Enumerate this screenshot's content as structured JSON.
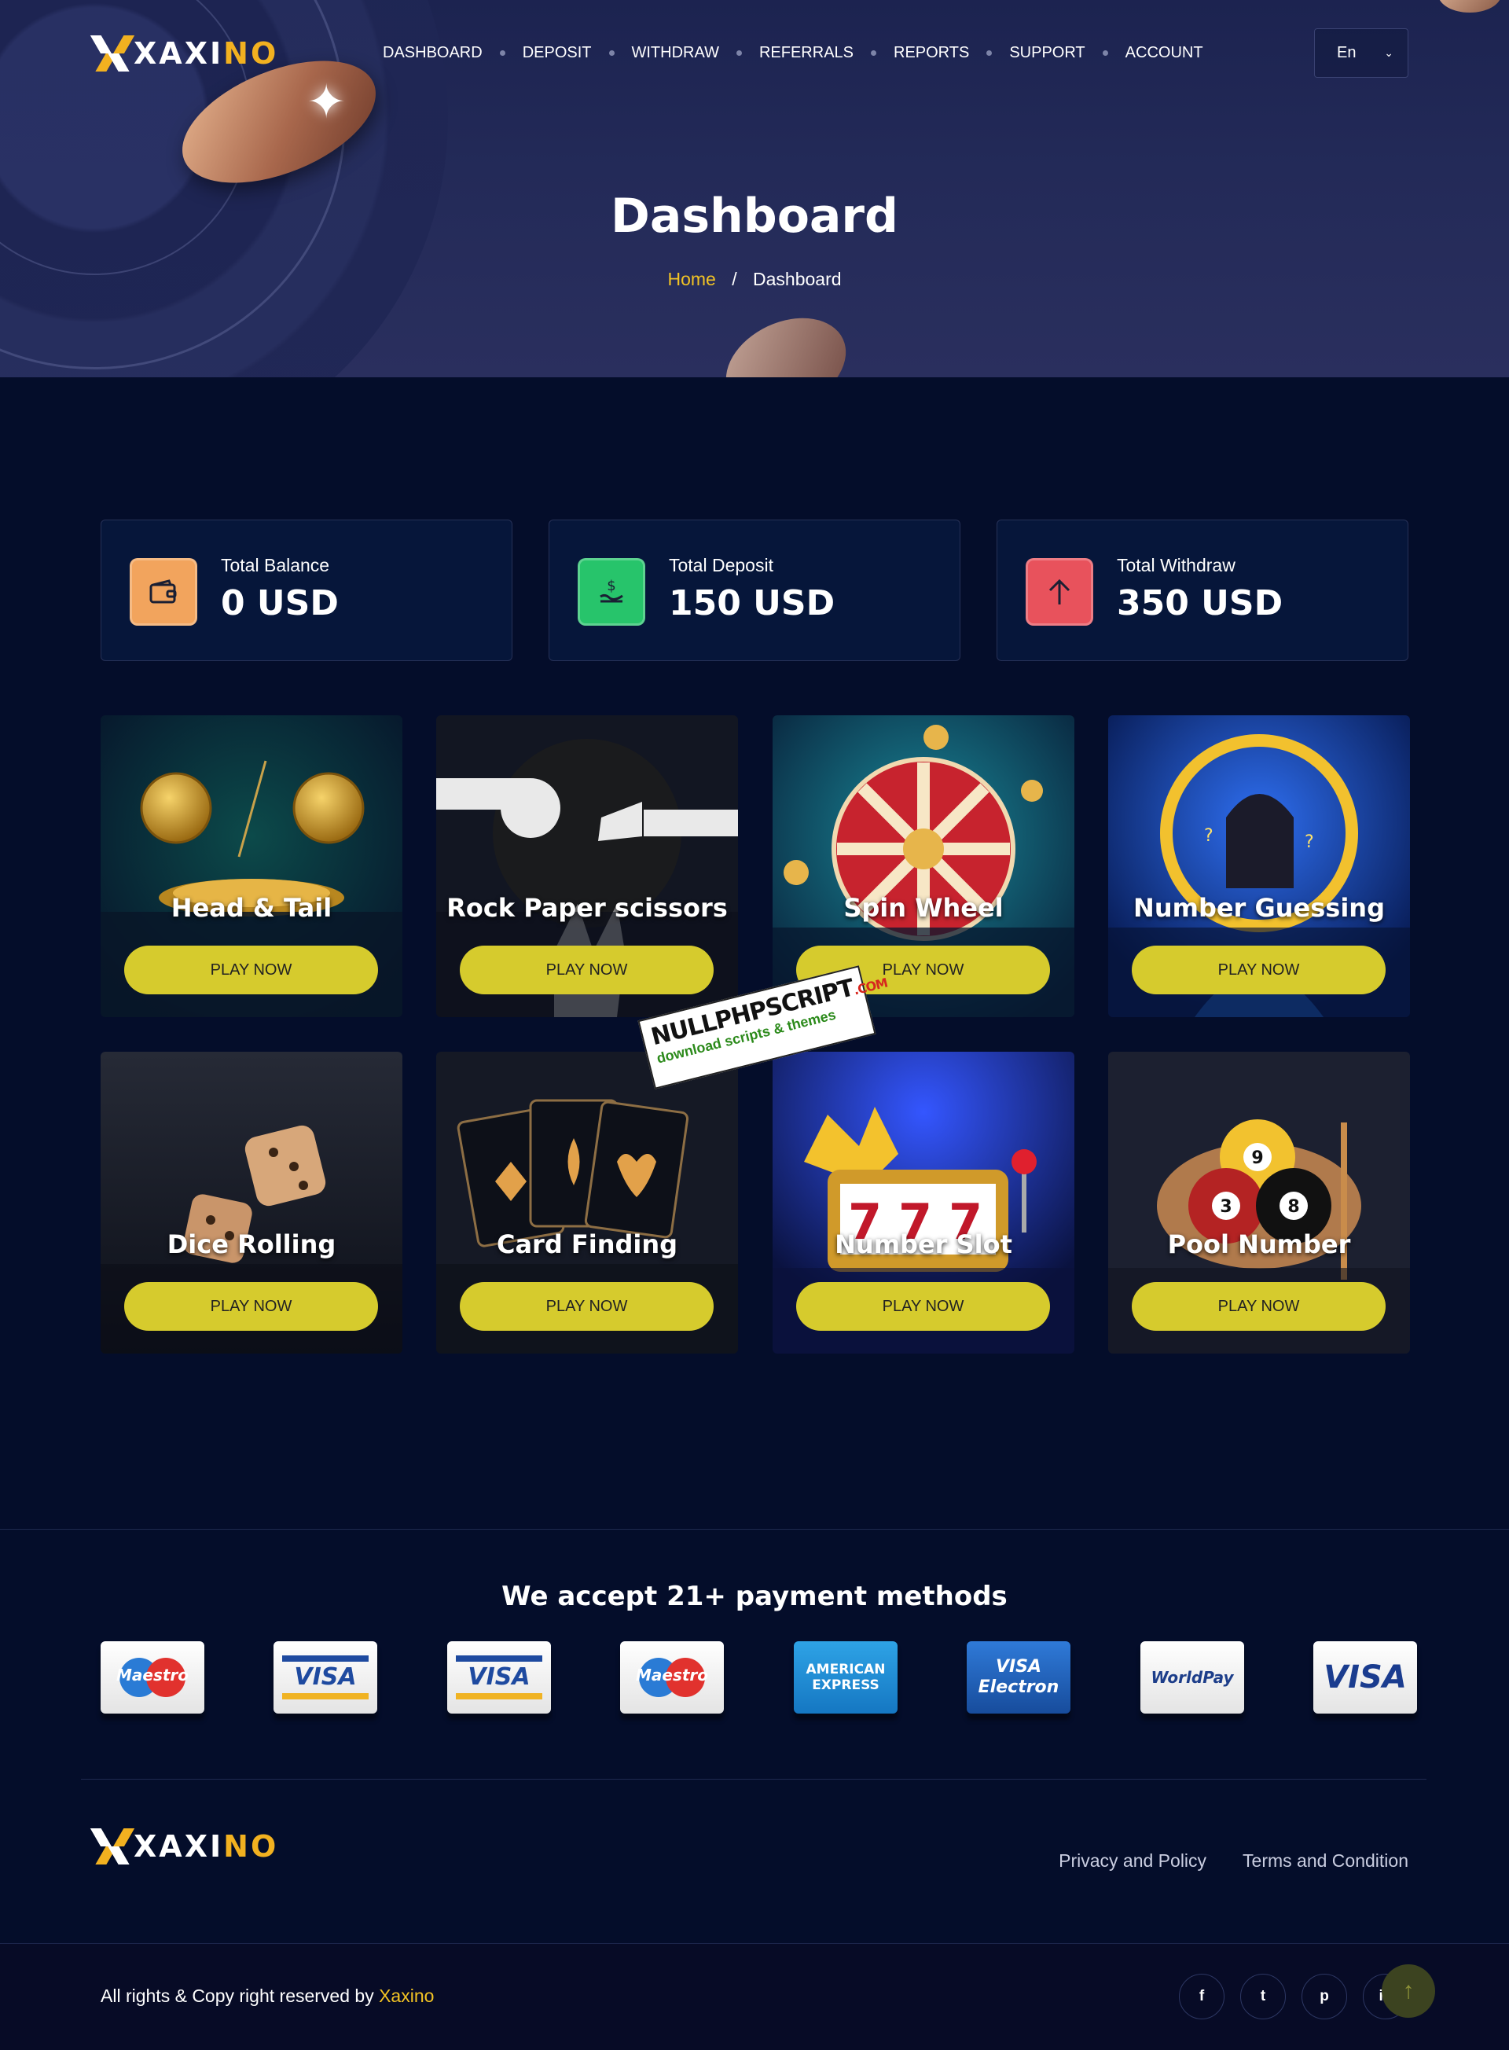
{
  "brand": {
    "name_main": "XAXI",
    "name_accent": "NO"
  },
  "nav": {
    "items": [
      "DASHBOARD",
      "DEPOSIT",
      "WITHDRAW",
      "REFERRALS",
      "REPORTS",
      "SUPPORT",
      "ACCOUNT"
    ],
    "language": "En"
  },
  "hero": {
    "title": "Dashboard",
    "breadcrumb_home": "Home",
    "breadcrumb_sep": "/",
    "breadcrumb_current": "Dashboard"
  },
  "stats": [
    {
      "label": "Total Balance",
      "value": "0 USD",
      "icon": "wallet-icon",
      "color": "#f2a45d"
    },
    {
      "label": "Total Deposit",
      "value": "150 USD",
      "icon": "deposit-icon",
      "color": "#27c46b"
    },
    {
      "label": "Total Withdraw",
      "value": "350 USD",
      "icon": "arrow-up-icon",
      "color": "#e8525c"
    }
  ],
  "games": [
    {
      "title": "Head & Tail",
      "button": "PLAY NOW"
    },
    {
      "title": "Rock Paper scissors",
      "button": "PLAY NOW"
    },
    {
      "title": "Spin Wheel",
      "button": "PLAY NOW"
    },
    {
      "title": "Number Guessing",
      "button": "PLAY NOW"
    },
    {
      "title": "Dice Rolling",
      "button": "PLAY NOW"
    },
    {
      "title": "Card Finding",
      "button": "PLAY NOW"
    },
    {
      "title": "Number Slot",
      "button": "PLAY NOW"
    },
    {
      "title": "Pool Number",
      "button": "PLAY NOW"
    }
  ],
  "watermark": {
    "main": "NULLPHPSCRIPT",
    "com": ".COM",
    "sub": "download scripts & themes"
  },
  "payments": {
    "title": "We accept 21+ payment methods",
    "methods": [
      "Maestro",
      "VISA",
      "VISA",
      "Maestro",
      "AMERICAN EXPRESS",
      "VISA Electron",
      "WorldPay",
      "VISA"
    ]
  },
  "footer": {
    "privacy": "Privacy and Policy",
    "terms": "Terms and Condition",
    "copyright_prefix": "All rights & Copy right reserved by ",
    "copyright_brand": "Xaxino",
    "socials": [
      "f",
      "t",
      "p",
      "in"
    ],
    "to_top": "↑"
  }
}
